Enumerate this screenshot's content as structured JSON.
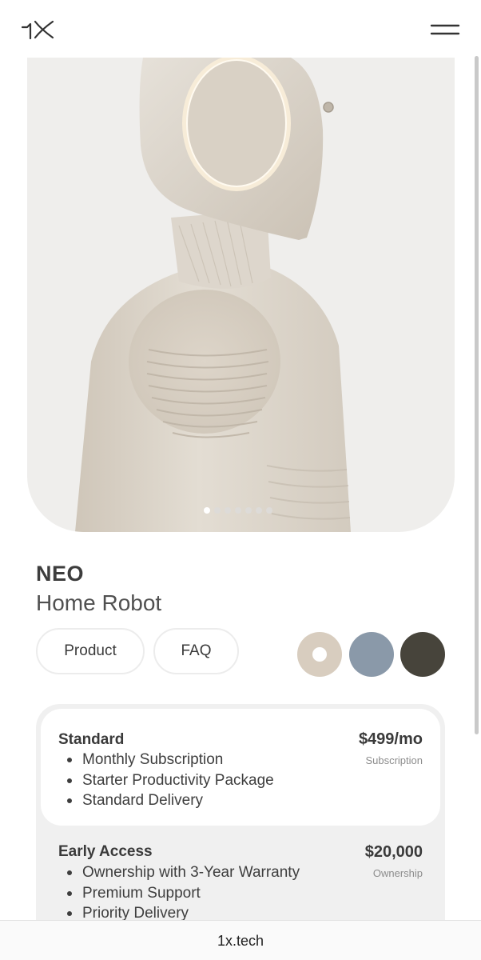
{
  "header": {
    "logo_icon": "1x-logo-icon",
    "menu_icon": "hamburger-menu-icon"
  },
  "hero": {
    "image_subject": "humanoid robot side profile",
    "carousel": {
      "count": 7,
      "active_index": 0
    }
  },
  "product": {
    "title": "NEO",
    "subtitle": "Home Robot"
  },
  "tabs": [
    {
      "label": "Product"
    },
    {
      "label": "FAQ"
    }
  ],
  "color_options": [
    {
      "color": "#d8cdbf",
      "selected": true
    },
    {
      "color": "#8a99a9",
      "selected": false
    },
    {
      "color": "#47443b",
      "selected": false
    }
  ],
  "plans": [
    {
      "name": "Standard",
      "price": "$499/mo",
      "kind": "Subscription",
      "features": [
        "Monthly Subscription",
        "Starter Productivity Package",
        "Standard Delivery"
      ]
    },
    {
      "name": "Early Access",
      "price": "$20,000",
      "kind": "Ownership",
      "features": [
        "Ownership with 3-Year Warranty",
        "Premium Support",
        "Priority Delivery"
      ]
    }
  ],
  "browser": {
    "url": "1x.tech"
  }
}
